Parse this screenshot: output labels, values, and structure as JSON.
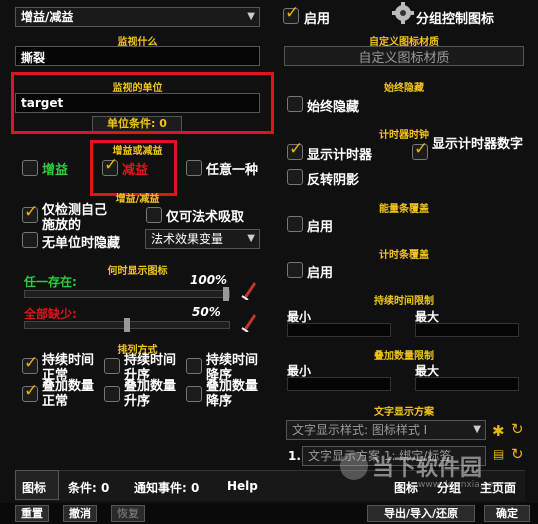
{
  "header": {
    "trigger_dropdown": "增益/减益",
    "enable_label": "启用",
    "group_icon_label": "分组控制图标"
  },
  "left": {
    "monitor_what_title": "监视什么",
    "monitor_what_value": "撕裂",
    "monitor_unit_title": "监视的单位",
    "monitor_unit_value": "target",
    "unit_condition_label": "单位条件: 0",
    "buff_or_debuff_title": "增益或减益",
    "buff_label": "增益",
    "debuff_label": "减益",
    "any_label": "任意一种",
    "buff_debuff_title2": "增益/减益",
    "only_mine_label": "仅检测自己施放的",
    "only_stealable_label": "仅可法术吸取",
    "hide_no_unit_label": "无单位时隐藏",
    "spell_effect_var": "法术效果变量",
    "when_show_title": "何时显示图标",
    "any_exists_label": "任一存在:",
    "any_exists_value": "100%",
    "any_exists_fraction": 1.0,
    "all_missing_label": "全部缺少:",
    "all_missing_value": "50%",
    "all_missing_fraction": 0.5,
    "sort_title": "排列方式",
    "sort_items": [
      "持续时间正常",
      "持续时间升序",
      "持续时间降序",
      "叠加数量正常",
      "叠加数量升序",
      "叠加数量降序"
    ]
  },
  "right": {
    "custom_tex_title": "自定义图标材质",
    "custom_tex_placeholder": "自定义图标材质",
    "always_hide_title": "始终隐藏",
    "always_hide_label": "始终隐藏",
    "timer_title": "计时器时钟",
    "show_timer_label": "显示计时器",
    "show_timer_digits_label": "显示计时器数字",
    "reverse_shadow_label": "反转阴影",
    "power_bar_title": "能量条覆盖",
    "power_enable_label": "启用",
    "timer_bar_title": "计时条覆盖",
    "timer_enable_label": "启用",
    "duration_limit_title": "持续时间限制",
    "min_label": "最小",
    "max_label": "最大",
    "stack_limit_title": "叠加数量限制",
    "stack_min_label": "最小",
    "stack_max_label": "最大",
    "text_scheme_title": "文字显示方案",
    "text_style_dropdown": "文字显示样式: 图标样式 I",
    "text_scheme_row_num": "1.",
    "text_scheme_row": "文字显示方案 1: 绑定/标签"
  },
  "bottom_tabs": {
    "icon": "图标",
    "conditions": "条件: 0",
    "notify": "通知事件: 0",
    "help": "Help",
    "r_icon": "图标",
    "r_group": "分组",
    "r_main": "主页面"
  },
  "footer": {
    "reset": "重置",
    "undo": "撤消",
    "redo": "恢复",
    "export_import": "导出/导入/还原",
    "ok": "确定"
  },
  "watermark": {
    "text": "当下软件园",
    "url": "www.downxia.com"
  }
}
